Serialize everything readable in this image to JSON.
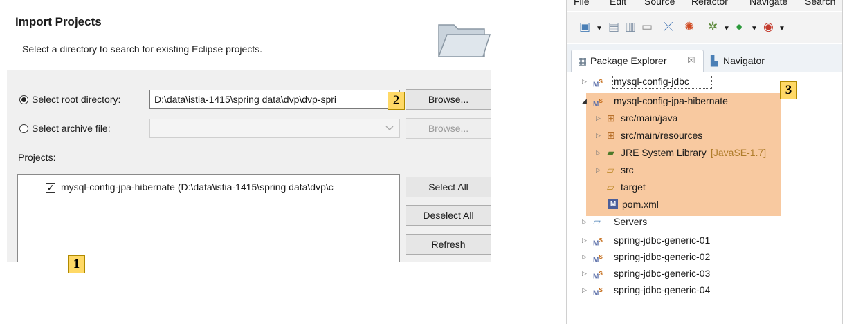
{
  "import_dialog": {
    "title": "Import Projects",
    "subtitle": "Select a directory to search for existing Eclipse projects.",
    "root_dir_label": "Select root directory:",
    "root_dir_value": "D:\\data\\istia-1415\\spring data\\dvp\\dvp-spri",
    "archive_label": "Select archive file:",
    "archive_value": "",
    "browse_label": "Browse...",
    "browse_archive_label": "Browse...",
    "projects_label": "Projects:",
    "projects": [
      {
        "label": "mysql-config-jpa-hibernate (D:\\data\\istia-1415\\spring data\\dvp\\c",
        "checked": true
      }
    ],
    "select_all": "Select All",
    "deselect_all": "Deselect All",
    "refresh": "Refresh",
    "check_glyph": "✓"
  },
  "badges": {
    "one": "1",
    "two": "2",
    "three": "3"
  },
  "eclipse": {
    "menu": [
      "File",
      "Edit",
      "Source",
      "Refactor",
      "Navigate",
      "Search"
    ],
    "tabs": {
      "package_explorer": "Package Explorer",
      "close_glyph": "☒",
      "navigator": "Navigator"
    },
    "tree": [
      {
        "label": "mysql-config-jdbc",
        "icon": "maven-project-icon",
        "expanded": false
      },
      {
        "label": "mysql-config-jpa-hibernate",
        "icon": "maven-project-icon",
        "expanded": true
      },
      {
        "label": "src/main/java",
        "icon": "source-folder-icon"
      },
      {
        "label": "src/main/resources",
        "icon": "source-folder-icon"
      },
      {
        "label": "JRE System Library",
        "suffix": "[JavaSE-1.7]",
        "icon": "library-icon"
      },
      {
        "label": "src",
        "icon": "folder-icon"
      },
      {
        "label": "target",
        "icon": "folder-icon"
      },
      {
        "label": "pom.xml",
        "icon": "maven-pom-icon"
      },
      {
        "label": "Servers",
        "icon": "folder-icon"
      },
      {
        "label": "spring-jdbc-generic-01",
        "icon": "maven-project-icon"
      },
      {
        "label": "spring-jdbc-generic-02",
        "icon": "maven-project-icon"
      },
      {
        "label": "spring-jdbc-generic-03",
        "icon": "maven-project-icon"
      },
      {
        "label": "spring-jdbc-generic-04",
        "icon": "maven-project-icon"
      }
    ]
  },
  "colors": {
    "highlight": "#f8c9a0",
    "badge": "#ffd966"
  }
}
